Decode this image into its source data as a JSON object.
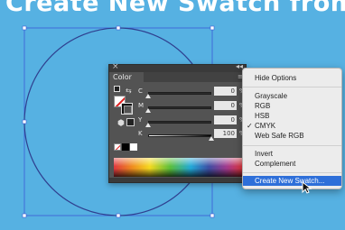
{
  "header": {
    "text": "Create New Swatch from Color"
  },
  "color_panel": {
    "close_glyph": "×",
    "collapse_glyph": "◂◂",
    "tab_label": "Color",
    "menu_glyph": "≡",
    "sliders": [
      {
        "label": "C",
        "value": "0",
        "unit": "%",
        "level": 0.0
      },
      {
        "label": "M",
        "value": "0",
        "unit": "%",
        "level": 0.0
      },
      {
        "label": "Y",
        "value": "0",
        "unit": "%",
        "level": 0.0
      },
      {
        "label": "K",
        "value": "100",
        "unit": "%",
        "level": 1.0
      }
    ]
  },
  "context_menu": {
    "items": [
      {
        "label": "Hide Options",
        "checked": false,
        "highlighted": false
      },
      {
        "label": "Grayscale",
        "checked": false,
        "highlighted": false
      },
      {
        "label": "RGB",
        "checked": false,
        "highlighted": false
      },
      {
        "label": "HSB",
        "checked": false,
        "highlighted": false
      },
      {
        "label": "CMYK",
        "checked": true,
        "highlighted": false
      },
      {
        "label": "Web Safe RGB",
        "checked": false,
        "highlighted": false
      },
      {
        "label": "Invert",
        "checked": false,
        "highlighted": false
      },
      {
        "label": "Complement",
        "checked": false,
        "highlighted": false
      },
      {
        "label": "Create New Swatch...",
        "checked": false,
        "highlighted": true
      }
    ],
    "check_glyph": "✓"
  },
  "colors": {
    "canvas_background": "#56b1e2",
    "circle_stroke": "#2f3f8f",
    "selection_bounds": "#3b5bd6",
    "menu_highlight": "#2e6fd9"
  },
  "icons": [
    "close-icon",
    "collapse-icon",
    "panel-menu-icon",
    "swap-fill-stroke-icon",
    "default-fill-stroke-icon",
    "out-of-gamut-icon",
    "mouse-pointer-icon"
  ]
}
